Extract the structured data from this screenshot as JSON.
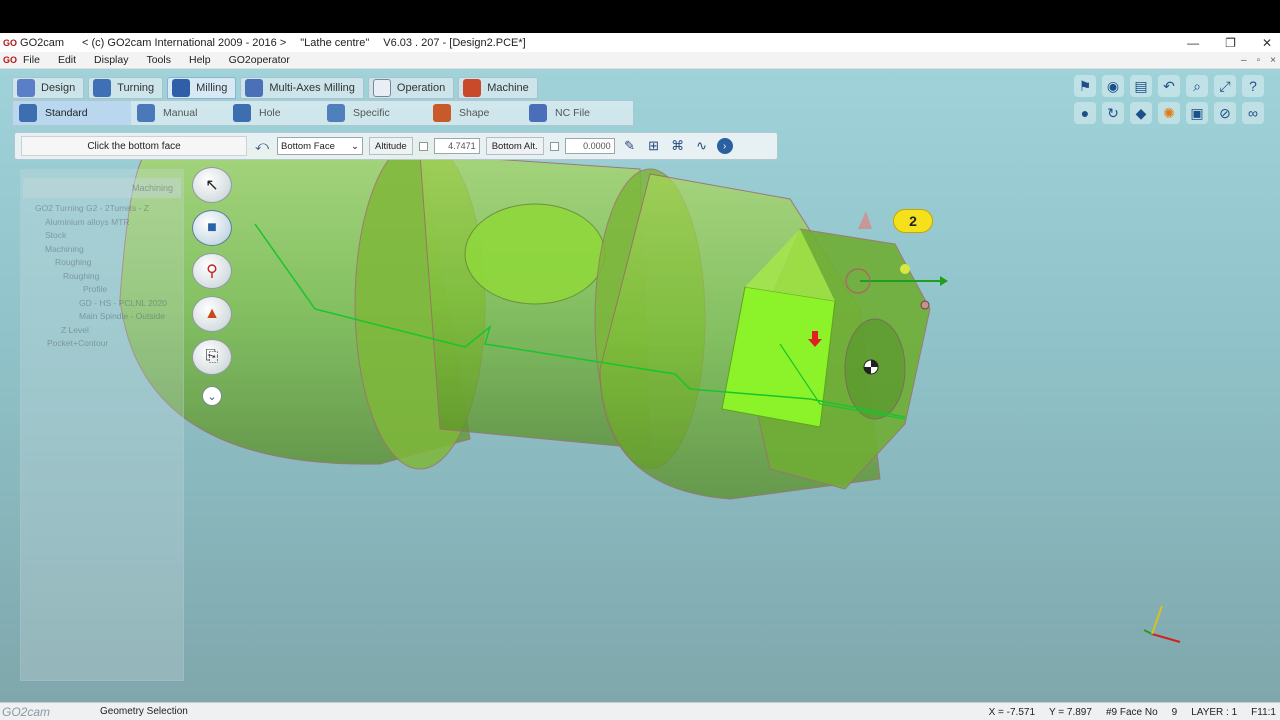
{
  "title_bar": {
    "logo": "GO",
    "app_name": "GO2cam",
    "copyright": "< (c) GO2cam International 2009 - 2016 >",
    "machine": "\"Lathe centre\"",
    "version_file": "V6.03 . 207 - [Design2.PCE*]",
    "minimize": "—",
    "restore": "❐",
    "close": "✕"
  },
  "menu": {
    "logo": "GO",
    "items": [
      "File",
      "Edit",
      "Display",
      "Tools",
      "Help",
      "GO2operator"
    ],
    "mdi_minimize": "–",
    "mdi_restore": "▫",
    "mdi_close": "×"
  },
  "tabs": [
    "Design",
    "Turning",
    "Milling",
    "Multi-Axes Milling",
    "Operation",
    "Machine"
  ],
  "active_tab": "Milling",
  "subtabs": [
    "Standard",
    "Manual",
    "Hole",
    "Specific",
    "Shape",
    "NC File"
  ],
  "options": {
    "prompt": "Click the bottom face",
    "face_select": "Bottom Face",
    "altitude_label": "Altitude",
    "altitude_value": "4.7471",
    "bottom_alt_label": "Bottom Alt.",
    "bottom_alt_value": "0.0000"
  },
  "tree": {
    "header": "Machining",
    "items": [
      "GO2 Turning G2 - 2Turrets - Z",
      "Aluminium alloys MTR",
      "Stock",
      "Machining",
      "Roughing",
      "Roughing",
      "Profile",
      "GD - HS - PCLNL 2020",
      "Main Spindle - Outside",
      "Z Level",
      "Pocket+Contour"
    ]
  },
  "badge": "2",
  "status": {
    "logo": "GO2cam",
    "mode": "Geometry Selection",
    "x": "X = -7.571",
    "y": "Y = 7.897",
    "face": "#9 Face No",
    "face_no": "9",
    "layer": "LAYER : 1",
    "scale": "F11:1"
  },
  "colors": {
    "part": "#7fbf3a",
    "selected_face": "#8cf22a",
    "toolpath": "#19c42d",
    "background_top": "#9fd3d9"
  }
}
